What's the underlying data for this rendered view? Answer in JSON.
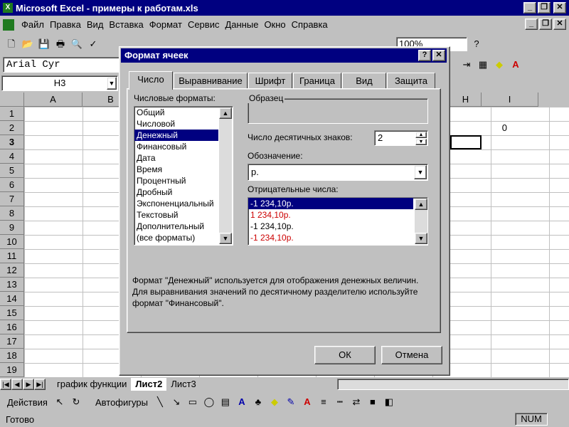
{
  "window": {
    "title": "Microsoft Excel - примеры к работам.xls"
  },
  "menu": [
    "Файл",
    "Правка",
    "Вид",
    "Вставка",
    "Формат",
    "Сервис",
    "Данные",
    "Окно",
    "Справка"
  ],
  "toolbar": {
    "zoom": "100%"
  },
  "formula": {
    "font": "Arial Cyr",
    "name_box": "H3"
  },
  "columns": [
    "A",
    "B",
    "H",
    "I"
  ],
  "rows": [
    "1",
    "2",
    "3",
    "4",
    "5",
    "6",
    "7",
    "8",
    "9",
    "10",
    "11",
    "12",
    "13",
    "14",
    "15",
    "16",
    "17",
    "18",
    "19"
  ],
  "cells": {
    "i2": "0"
  },
  "dialog": {
    "title": "Формат ячеек",
    "tabs": [
      "Число",
      "Выравнивание",
      "Шрифт",
      "Граница",
      "Вид",
      "Защита"
    ],
    "formats_label": "Числовые форматы:",
    "formats": [
      "Общий",
      "Числовой",
      "Денежный",
      "Финансовый",
      "Дата",
      "Время",
      "Процентный",
      "Дробный",
      "Экспоненциальный",
      "Текстовый",
      "Дополнительный",
      "(все форматы)"
    ],
    "sample_label": "Образец",
    "decimals_label": "Число десятичных знаков:",
    "decimals_value": "2",
    "symbol_label": "Обозначение:",
    "symbol_value": "р.",
    "negative_label": "Отрицательные числа:",
    "negatives": [
      "-1 234,10р.",
      "1 234,10р.",
      "-1 234,10р.",
      "-1 234,10р."
    ],
    "description": "Формат \"Денежный\" используется для отображения денежных величин. Для выравнивания значений по десятичному разделителю используйте формат \"Финансовый\".",
    "ok": "ОК",
    "cancel": "Отмена",
    "help_btn": "?",
    "close_btn": "✕"
  },
  "sheets": [
    "график функции",
    "Лист2",
    "Лист3"
  ],
  "drawing": {
    "actions": "Действия",
    "autoshapes": "Автофигуры"
  },
  "status": {
    "text": "Готово",
    "num": "NUM"
  },
  "colors": {
    "title": "#000080",
    "negative_red": "#cc0000"
  }
}
